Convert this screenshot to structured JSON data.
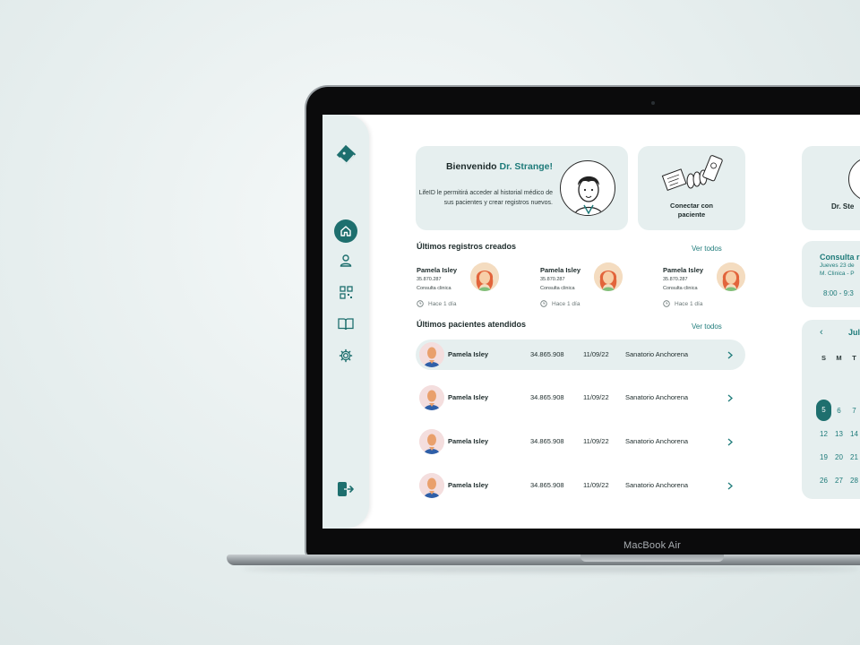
{
  "device": {
    "brand_label": "MacBook Air"
  },
  "sidebar": {
    "items": [
      {
        "icon": "book-logo-icon"
      },
      {
        "icon": "home-icon",
        "active": true
      },
      {
        "icon": "user-icon"
      },
      {
        "icon": "qr-code-icon"
      },
      {
        "icon": "open-book-icon"
      },
      {
        "icon": "gear-icon"
      },
      {
        "icon": "logout-icon"
      }
    ]
  },
  "welcome": {
    "greeting": "Bienvenido ",
    "doctor_name": "Dr. Strange!",
    "description": "LifeID le permitirá acceder al historial médico de sus pacientes y crear registros nuevos."
  },
  "connect": {
    "label": "Conectar con paciente"
  },
  "right_panel": {
    "doctor_name_partial": "Dr. Ste",
    "appointment": {
      "title_partial": "Consulta r",
      "date_partial": "Jueves 23 de",
      "place_partial": "M. Clinica - P",
      "time_partial": "8:00 - 9:3"
    },
    "calendar": {
      "prev_symbol": "‹",
      "month_partial": "Jul",
      "weekdays": [
        "S",
        "M",
        "T"
      ],
      "rows": [
        [
          "5",
          "6",
          "7"
        ],
        [
          "12",
          "13",
          "14"
        ],
        [
          "19",
          "20",
          "21"
        ],
        [
          "26",
          "27",
          "28"
        ]
      ],
      "selected_day": "5"
    }
  },
  "records": {
    "title": "Últimos registros creados",
    "see_all": "Ver todos",
    "items": [
      {
        "name": "Pamela Isley",
        "number": "35.870.287",
        "type": "Consulta clinica",
        "time": "Hace 1 día"
      },
      {
        "name": "Pamela Isley",
        "number": "35.870.287",
        "type": "Consulta clinica",
        "time": "Hace 1 día"
      },
      {
        "name": "Pamela Isley",
        "number": "35.870.287",
        "type": "Consulta clinica",
        "time": "Hace 1 día"
      }
    ]
  },
  "patients": {
    "title": "Últimos pacientes atendidos",
    "see_all": "Ver todos",
    "rows": [
      {
        "name": "Pamela Isley",
        "id": "34.865.908",
        "date": "11/09/22",
        "place": "Sanatorio Anchorena"
      },
      {
        "name": "Pamela Isley",
        "id": "34.865.908",
        "date": "11/09/22",
        "place": "Sanatorio Anchorena"
      },
      {
        "name": "Pamela Isley",
        "id": "34.865.908",
        "date": "11/09/22",
        "place": "Sanatorio Anchorena"
      },
      {
        "name": "Pamela Isley",
        "id": "34.865.908",
        "date": "11/09/22",
        "place": "Sanatorio Anchorena"
      }
    ]
  },
  "colors": {
    "accent": "#1e7b7a",
    "panel": "#e6efef",
    "active": "#1e6f6e"
  }
}
